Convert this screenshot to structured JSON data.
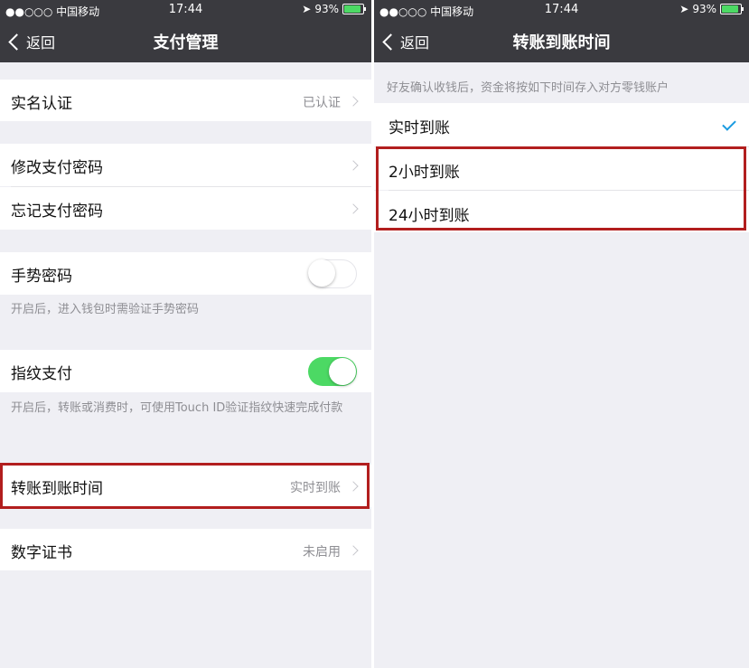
{
  "status": {
    "carrier": "●●○○○ 中国移动",
    "wifi_icon": "wifi-icon",
    "time": "17:44",
    "battery": "93%"
  },
  "left": {
    "back_label": "返回",
    "title": "支付管理",
    "realname": {
      "label": "实名认证",
      "value": "已认证"
    },
    "change_pwd": {
      "label": "修改支付密码"
    },
    "forget_pwd": {
      "label": "忘记支付密码"
    },
    "gesture": {
      "label": "手势密码",
      "enabled": false,
      "footer": "开启后，进入钱包时需验证手势密码"
    },
    "fingerprint": {
      "label": "指纹支付",
      "enabled": true,
      "footer": "开启后，转账或消费时，可使用Touch ID验证指纹快速完成付款"
    },
    "transfer_time": {
      "label": "转账到账时间",
      "value": "实时到账"
    },
    "certificate": {
      "label": "数字证书",
      "value": "未启用"
    }
  },
  "right": {
    "back_label": "返回",
    "title": "转账到账时间",
    "header_note": "好友确认收钱后，资金将按如下时间存入对方零钱账户",
    "options": [
      {
        "label": "实时到账",
        "selected": true
      },
      {
        "label": "2小时到账",
        "selected": false
      },
      {
        "label": "24小时到账",
        "selected": false
      }
    ]
  },
  "colors": {
    "nav_bg": "#3a3a3f",
    "toggle_on": "#4cd964",
    "highlight": "#b21e1e",
    "check": "#1a9be0"
  }
}
